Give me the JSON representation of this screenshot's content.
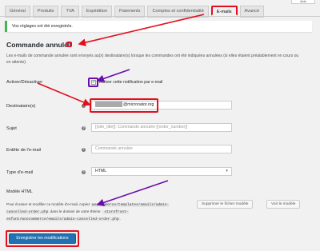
{
  "help_tab": "Aide",
  "tabs": [
    {
      "label": "Général"
    },
    {
      "label": "Produits"
    },
    {
      "label": "TVA"
    },
    {
      "label": "Expédition"
    },
    {
      "label": "Paiements"
    },
    {
      "label": "Comptes et confidentialité"
    },
    {
      "label": "E-mails"
    },
    {
      "label": "Avancé"
    }
  ],
  "active_tab": "E-mails",
  "notice": "Vos réglages ont été enregistrés.",
  "section": {
    "title": "Commande annulée",
    "help_badge": "i",
    "description": "Les e-mails de commande annulée sont envoyés au(x) destinataire(s) lorsque les commandes ont été indiquées annulées (si elles étaient préalablement en cours ou en attente)."
  },
  "fields": {
    "enable": {
      "label": "Activer/Désactiver",
      "checkbox_label": "Activer cette notification par e-mail",
      "checked": true
    },
    "recipient": {
      "label": "Destinataire(s)",
      "value_suffix": "@micronator.org"
    },
    "subject": {
      "label": "Sujet",
      "placeholder": "[{site_title}]: Commande annulée [{order_number}]"
    },
    "heading": {
      "label": "Entête de l'e-mail",
      "placeholder": "Commande annulée"
    },
    "email_type": {
      "label": "Type d'e-mail",
      "value": "HTML"
    }
  },
  "template": {
    "label": "Modèle HTML",
    "text_before": "Pour écraser et modifier ce modèle d'e-mail, copiez",
    "path_source": "woocommerce/templates/emails/admin-cancelled-order.php",
    "text_middle": "dans le dossier de votre thème :",
    "path_theme": "storefront-enfant/woocommerce/emails/admin-cancelled-order.php",
    "text_after": ".",
    "delete_button": "Supprimer le fichier modèle",
    "view_button": "Voir le modèle"
  },
  "save_button": "Enregistrer les modifications",
  "colors": {
    "annotation_red": "#e0101e",
    "annotation_purple": "#6a0dad",
    "primary": "#2271b1",
    "success": "#46b450"
  }
}
